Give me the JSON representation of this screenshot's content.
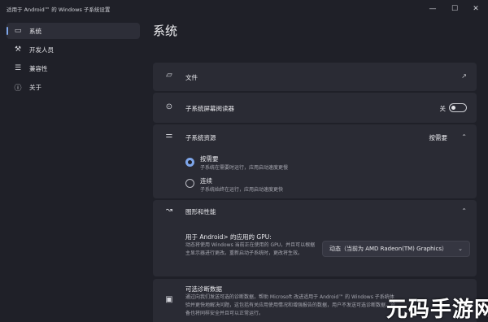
{
  "window": {
    "title": "适用于 Android™ 的 Windows 子系统设置",
    "minimize": "—",
    "maximize": "☐",
    "close": "✕"
  },
  "sidebar": {
    "items": [
      {
        "label": "系统",
        "icon": "monitor-icon",
        "glyph": "▭",
        "active": true
      },
      {
        "label": "开发人员",
        "icon": "developer-icon",
        "glyph": "⚒",
        "active": false
      },
      {
        "label": "兼容性",
        "icon": "sliders-icon",
        "glyph": "☰",
        "active": false
      },
      {
        "label": "关于",
        "icon": "info-icon",
        "glyph": "ⓘ",
        "active": false
      }
    ]
  },
  "main": {
    "title": "系统",
    "files": {
      "label": "文件",
      "icon_glyph": "▱",
      "link_glyph": "↗"
    },
    "screen_reader": {
      "label": "子系统屏幕阅读器",
      "icon_glyph": "⊙",
      "toggle_state": "关"
    },
    "resources": {
      "label": "子系统资源",
      "icon_glyph": "⚌",
      "value": "按需要",
      "chevron": "⌃",
      "options": [
        {
          "title": "按需要",
          "desc": "子系统在需要时运行，应用启动速度更慢",
          "checked": true
        },
        {
          "title": "连续",
          "desc": "子系统始终在运行，应用启动速度更快",
          "checked": false
        }
      ]
    },
    "graphics": {
      "label": "图形和性能",
      "icon_glyph": "↝",
      "chevron": "⌃",
      "gpu_title": "用于 Android> 的应用的 GPU:",
      "gpu_desc": "动态将使用 Windows 当前正在使用的 GPU，并且可以根据主显示器进行更改。重新启动子系统时，更改将生效。",
      "gpu_selected": "动态（当前为 AMD Radeon(TM) Graphics）",
      "select_chevron": "⌄"
    },
    "diagnostics": {
      "label": "可选诊断数据",
      "icon_glyph": "▣",
      "desc": "通过向我们发送可选的诊断数据，帮助 Microsoft 改进适用于 Android™ 的 Windows 子系统体验并更快地解决问题，这包括有关应用使用情况和增强报告的数据，用户不发送可选诊断数据，设备也将同样安全并且可以正常运行。"
    }
  },
  "watermark": "元码手游网",
  "colors": {
    "background": "#1f2028",
    "card": "#2a2b34",
    "accent": "#7ea6ea"
  }
}
